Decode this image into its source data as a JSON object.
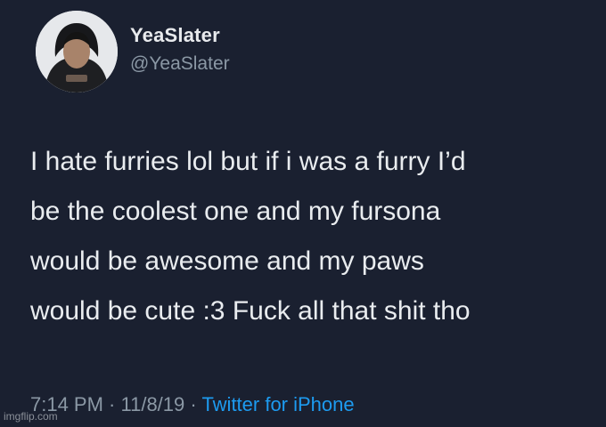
{
  "author": {
    "display_name": "YeaSlater",
    "handle": "@YeaSlater"
  },
  "tweet": {
    "lines": [
      "I hate furries lol but if i was a furry I’d",
      "be the coolest one and my fursona",
      "would be awesome and my paws",
      "would be cute :3 Fuck all that shit tho"
    ],
    "time": "7:14 PM",
    "separator": " · ",
    "date": "11/8/19",
    "source": "Twitter for iPhone"
  },
  "watermark": "imgflip.com",
  "colors": {
    "background": "#1a2030",
    "text": "#e9ecef",
    "muted": "#8b98a5",
    "link": "#1d9bf0"
  }
}
